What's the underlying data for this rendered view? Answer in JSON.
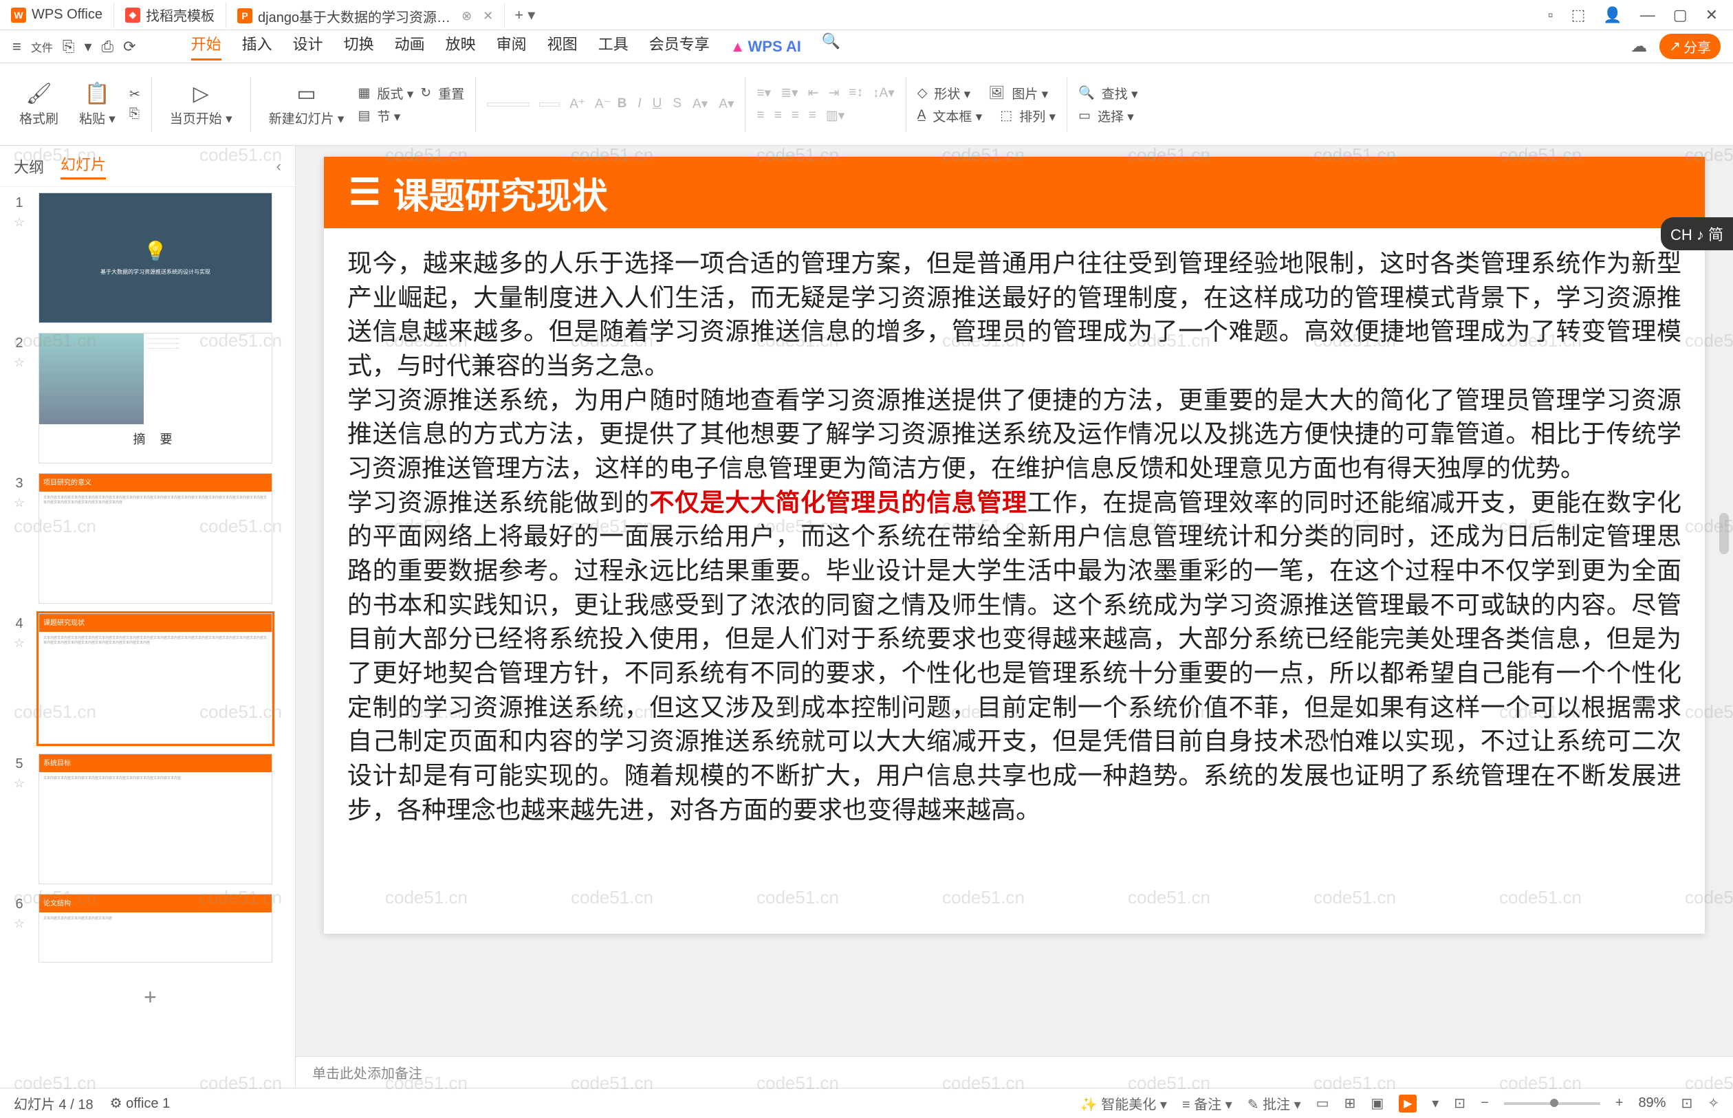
{
  "title_bar": {
    "tabs": [
      {
        "icon_color": "#ff6a00",
        "label": "WPS Office"
      },
      {
        "icon_color": "#ff4d3a",
        "label": "找稻壳模板"
      },
      {
        "icon_color": "#ff6a00",
        "label": "django基于大数据的学习资源…",
        "active": true
      }
    ],
    "add_icon": "+",
    "win_icons": [
      "▢",
      "⬚",
      "👤",
      "—",
      "▢",
      "✕"
    ]
  },
  "menu_bar": {
    "left_icons": [
      "≡",
      "文件",
      "⎘",
      "▾",
      "⎙",
      "⟳"
    ],
    "tabs": [
      "开始",
      "插入",
      "设计",
      "切换",
      "动画",
      "放映",
      "审阅",
      "视图",
      "工具",
      "会员专享"
    ],
    "active_tab": "开始",
    "wps_ai": "WPS AI",
    "search_icon": "🔍",
    "cloud_icon": "☁",
    "share": "分享"
  },
  "ribbon": {
    "format_brush": "格式刷",
    "paste": "粘贴",
    "from_page": "当页开始",
    "new_slide": "新建幻灯片",
    "layout": "版式",
    "section": "节",
    "reset": "重置",
    "shape": "形状",
    "image": "图片",
    "textbox": "文本框",
    "arrange": "排列",
    "find": "查找",
    "select": "选择"
  },
  "side": {
    "tab_outline": "大纲",
    "tab_slides": "幻灯片",
    "thumbs": [
      {
        "n": "1",
        "title": "基于大数据的学习资源推送系统的设计与实现"
      },
      {
        "n": "2",
        "title": "摘  要"
      },
      {
        "n": "3",
        "strip": "项目研究的意义"
      },
      {
        "n": "4",
        "strip": "课题研究现状",
        "selected": true
      },
      {
        "n": "5",
        "strip": "系统目标"
      },
      {
        "n": "6",
        "strip": "论文结构"
      }
    ],
    "add": "+"
  },
  "slide": {
    "title": "课题研究现状",
    "hamburger": "☰",
    "para1": "现今，越来越多的人乐于选择一项合适的管理方案，但是普通用户往往受到管理经验地限制，这时各类管理系统作为新型产业崛起，大量制度进入人们生活，而无疑是学习资源推送最好的管理制度，在这样成功的管理模式背景下，学习资源推送信息越来越多。但是随着学习资源推送信息的增多，管理员的管理成为了一个难题。高效便捷地管理成为了转变管理模式，与时代兼容的当务之急。",
    "para2": "学习资源推送系统，为用户随时随地查看学习资源推送提供了便捷的方法，更重要的是大大的简化了管理员管理学习资源推送信息的方式方法，更提供了其他想要了解学习资源推送系统及运作情况以及挑选方便快捷的可靠管道。相比于传统学习资源推送管理方法，这样的电子信息管理更为简洁方便，在维护信息反馈和处理意见方面也有得天独厚的优势。",
    "para3a": "学习资源推送系统能做到的",
    "para3red": "不仅是大大简化管理员的信息管理",
    "para3b": "工作，在提高管理效率的同时还能缩减开支，更能在数字化的平面网络上将最好的一面展示给用户，而这个系统在带给全新用户信息管理统计和分类的同时，还成为日后制定管理思路的重要数据参考。过程永远比结果重要。毕业设计是大学生活中最为浓墨重彩的一笔，在这个过程中不仅学到更为全面的书本和实践知识，更让我感受到了浓浓的同窗之情及师生情。这个系统成为学习资源推送管理最不可或缺的内容。尽管目前大部分已经将系统投入使用，但是人们对于系统要求也变得越来越高，大部分系统已经能完美处理各类信息，但是为了更好地契合管理方针，不同系统有不同的要求，个性化也是管理系统十分重要的一点，所以都希望自己能有一个个性化定制的学习资源推送系统，但这又涉及到成本控制问题，目前定制一个系统价值不菲，但是如果有这样一个可以根据需求自己制定页面和内容的学习资源推送系统就可以大大缩减开支，但是凭借目前自身技术恐怕难以实现，不过让系统可二次设计却是有可能实现的。随着规模的不断扩大，用户信息共享也成一种趋势。系统的发展也证明了系统管理在不断发展进步，各种理念也越来越先进，对各方面的要求也变得越来越高。"
  },
  "notes": {
    "placeholder": "单击此处添加备注"
  },
  "status": {
    "slide_counter": "幻灯片 4 / 18",
    "office": "office 1",
    "beautify": "智能美化",
    "notes": "备注",
    "comments": "批注",
    "zoom": "89%"
  },
  "lang_badge": "CH ♪ 简",
  "watermark": "code51.cn"
}
